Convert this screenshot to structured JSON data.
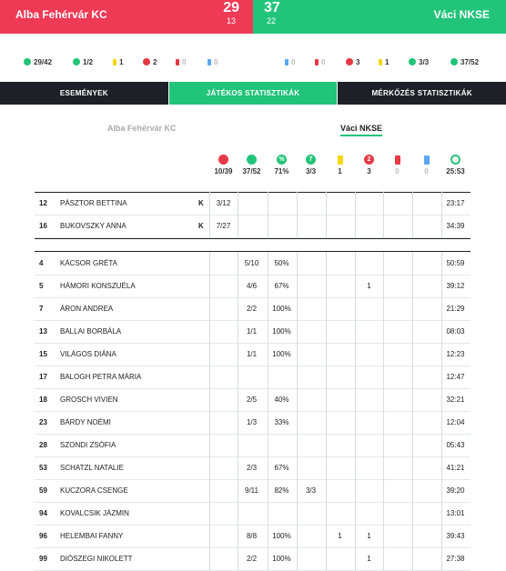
{
  "scoreboard": {
    "home": {
      "name": "Alba Fehérvár KC",
      "score": "29",
      "sub": "13",
      "color": "#ef3a55"
    },
    "away": {
      "name": "Váci NKSE",
      "score": "37",
      "sub": "22",
      "color": "#22c47a"
    }
  },
  "summary": {
    "home": [
      {
        "icon": "ball-icon",
        "value": "29/42"
      },
      {
        "icon": "penalty-icon",
        "value": "1/2"
      },
      {
        "icon": "yellow-card-icon",
        "value": "1"
      },
      {
        "icon": "two-min-icon",
        "value": "2"
      },
      {
        "icon": "red-card-icon",
        "value": "0"
      },
      {
        "icon": "blue-card-icon",
        "value": "0"
      }
    ],
    "away": [
      {
        "icon": "blue-card-icon",
        "value": "0"
      },
      {
        "icon": "red-card-icon",
        "value": "0"
      },
      {
        "icon": "two-min-icon",
        "value": "3"
      },
      {
        "icon": "yellow-card-icon",
        "value": "1"
      },
      {
        "icon": "penalty-icon",
        "value": "3/3"
      },
      {
        "icon": "ball-icon",
        "value": "37/52"
      }
    ]
  },
  "tabs": [
    "ESEMÉNYEK",
    "JÁTÉKOS STATISZTIKÁK",
    "MÉRKŐZÉS STATISZTIKÁK"
  ],
  "active_tab": 1,
  "team_selector": {
    "home": "Alba Fehérvár KC",
    "away": "Váci NKSE"
  },
  "columns": [
    {
      "icon": "saves-icon",
      "glyph": "",
      "total": "10/39"
    },
    {
      "icon": "shots-icon",
      "glyph": "",
      "total": "37/52"
    },
    {
      "icon": "percent-icon",
      "glyph": "%",
      "total": "71%"
    },
    {
      "icon": "seven-meter-icon",
      "glyph": "7",
      "total": "3/3"
    },
    {
      "icon": "yellow-card-icon",
      "glyph": "",
      "total": "1"
    },
    {
      "icon": "two-min-icon",
      "glyph": "2",
      "total": "3"
    },
    {
      "icon": "red-card-icon",
      "glyph": "",
      "total": "0"
    },
    {
      "icon": "blue-card-icon",
      "glyph": "",
      "total": "0"
    },
    {
      "icon": "clock-icon",
      "glyph": "",
      "total": "25:53"
    }
  ],
  "goalkeepers": [
    {
      "num": "12",
      "name": "Pásztor Bettina",
      "k": "K",
      "saves": "3/12",
      "time": "23:17"
    },
    {
      "num": "16",
      "name": "Bukovszky Anna",
      "k": "K",
      "saves": "7/27",
      "time": "34:39"
    }
  ],
  "players": [
    {
      "num": "4",
      "name": "Kácsor Gréta",
      "shots": "5/10",
      "pct": "50%",
      "seven": "",
      "yc": "",
      "tm": "",
      "time": "50:59"
    },
    {
      "num": "5",
      "name": "Hámori Konszuéla",
      "shots": "4/6",
      "pct": "67%",
      "seven": "",
      "yc": "",
      "tm": "1",
      "time": "39:12"
    },
    {
      "num": "7",
      "name": "Áron Andrea",
      "shots": "2/2",
      "pct": "100%",
      "seven": "",
      "yc": "",
      "tm": "",
      "time": "21:29"
    },
    {
      "num": "13",
      "name": "Ballai Borbála",
      "shots": "1/1",
      "pct": "100%",
      "seven": "",
      "yc": "",
      "tm": "",
      "time": "08:03"
    },
    {
      "num": "15",
      "name": "Világos Diána",
      "shots": "1/1",
      "pct": "100%",
      "seven": "",
      "yc": "",
      "tm": "",
      "time": "12:23"
    },
    {
      "num": "17",
      "name": "Balogh Petra Mária",
      "shots": "",
      "pct": "",
      "seven": "",
      "yc": "",
      "tm": "",
      "time": "12:47"
    },
    {
      "num": "18",
      "name": "Grosch Vivien",
      "shots": "2/5",
      "pct": "40%",
      "seven": "",
      "yc": "",
      "tm": "",
      "time": "32:21"
    },
    {
      "num": "23",
      "name": "Bárdy Noémi",
      "shots": "1/3",
      "pct": "33%",
      "seven": "",
      "yc": "",
      "tm": "",
      "time": "12:04"
    },
    {
      "num": "28",
      "name": "Szondi Zsófia",
      "shots": "",
      "pct": "",
      "seven": "",
      "yc": "",
      "tm": "",
      "time": "05:43"
    },
    {
      "num": "53",
      "name": "Schatzl Natalie",
      "shots": "2/3",
      "pct": "67%",
      "seven": "",
      "yc": "",
      "tm": "",
      "time": "41:21"
    },
    {
      "num": "59",
      "name": "Kuczora Csenge",
      "shots": "9/11",
      "pct": "82%",
      "seven": "3/3",
      "yc": "",
      "tm": "",
      "time": "39:20"
    },
    {
      "num": "94",
      "name": "Kovalcsik Jázmin",
      "shots": "",
      "pct": "",
      "seven": "",
      "yc": "",
      "tm": "",
      "time": "13:01"
    },
    {
      "num": "96",
      "name": "Helembai Fanny",
      "shots": "8/8",
      "pct": "100%",
      "seven": "",
      "yc": "1",
      "tm": "1",
      "time": "39:43"
    },
    {
      "num": "99",
      "name": "Diószegi Nikolett",
      "shots": "2/2",
      "pct": "100%",
      "seven": "",
      "yc": "",
      "tm": "1",
      "time": "27:38"
    }
  ]
}
